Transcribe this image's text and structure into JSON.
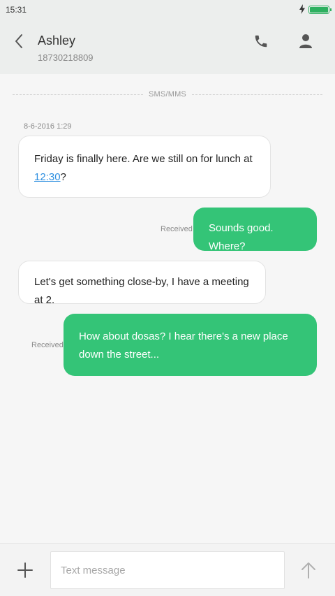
{
  "status_bar": {
    "time": "15:31",
    "battery_level": 1.0
  },
  "header": {
    "contact_name": "Ashley",
    "contact_number": "18730218809"
  },
  "thread": {
    "channel_label": "SMS/MMS",
    "timestamp": "8-6-2016 1:29",
    "messages": [
      {
        "direction": "incoming",
        "text": "Friday is finally here. Are we still on for lunch at ",
        "link": "12:30",
        "suffix": "?"
      },
      {
        "direction": "outgoing",
        "text": "Sounds good. Where?",
        "status": "Received"
      },
      {
        "direction": "incoming",
        "text": "Let's get something close-by, I have a meeting at 2."
      },
      {
        "direction": "outgoing",
        "text": "How about dosas? I hear there's a new place down the street...",
        "status": "Received"
      }
    ]
  },
  "composer": {
    "placeholder": "Text message"
  },
  "colors": {
    "accent_green": "#34c477",
    "link_blue": "#2e8fe0",
    "header_bg": "#eceeed"
  }
}
